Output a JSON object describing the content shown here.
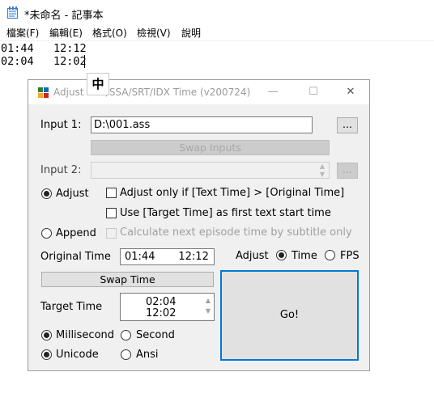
{
  "notepad": {
    "title": "*未命名 - 記事本",
    "menu": [
      "檔案(F)",
      "編輯(E)",
      "格式(O)",
      "檢視(V)",
      "說明"
    ],
    "lines": [
      "01:44   12:12",
      "02:04   12:02"
    ],
    "ime_indicator": "中"
  },
  "dialog": {
    "title": "Adjust ASS/SSA/SRT/IDX Time (v200724)",
    "input1_label": "Input 1:",
    "input1_value": "D:\\001.ass",
    "browse_label": "...",
    "swap_inputs_label": "Swap Inputs",
    "input2_label": "Input 2:",
    "input2_value": "",
    "adjust_radio_label": "Adjust",
    "adjust_only_if_label": "Adjust only if [Text Time] > [Original Time]",
    "use_target_label": "Use [Target Time] as first text start time",
    "append_radio_label": "Append",
    "calc_next_label": "Calculate next episode time by subtitle only",
    "original_time_label": "Original Time",
    "original_time_value": "01:44       12:12",
    "adjust_mode_label": "Adjust",
    "time_radio_label": "Time",
    "fps_radio_label": "FPS",
    "swap_time_label": "Swap Time",
    "target_time_label": "Target Time",
    "target_time_line1": "02:04",
    "target_time_line2": "12:02",
    "go_label": "Go!",
    "millisecond_label": "Millisecond",
    "second_label": "Second",
    "unicode_label": "Unicode",
    "ansi_label": "Ansi"
  }
}
